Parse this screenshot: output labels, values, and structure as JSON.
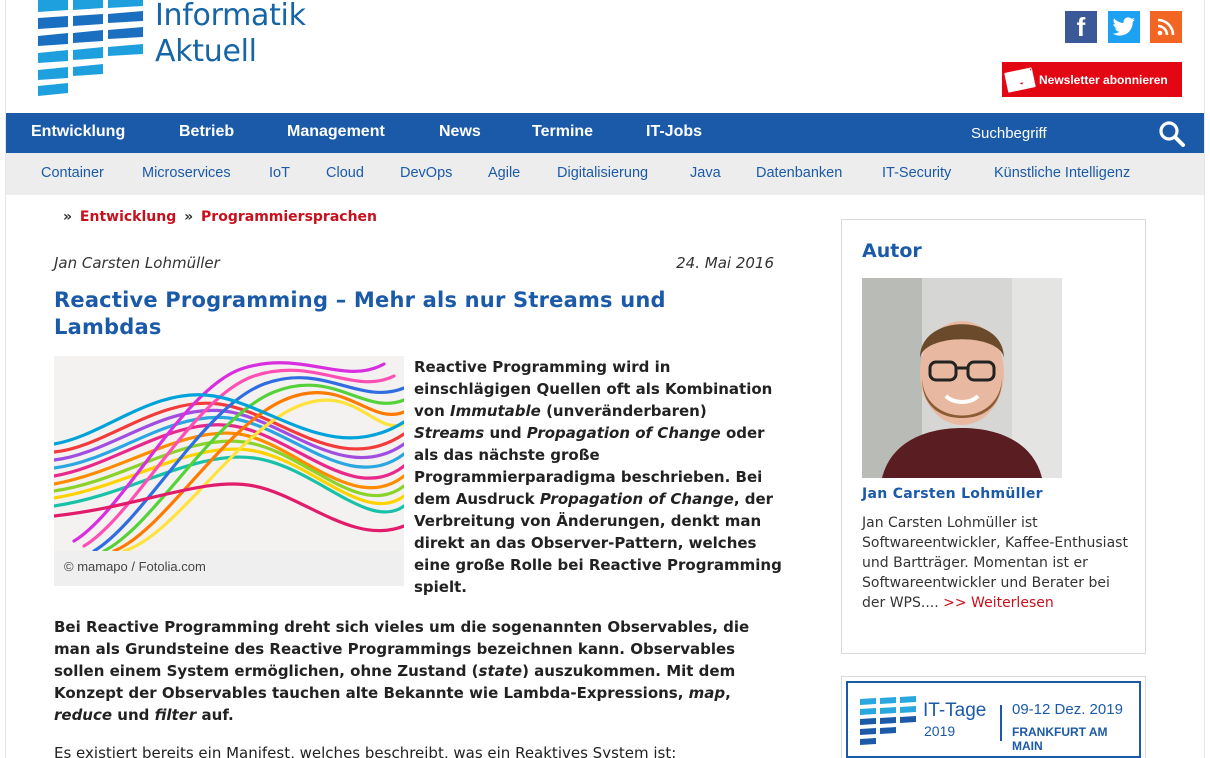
{
  "brand": {
    "name_line1": "Informatik",
    "name_line2": "Aktuell"
  },
  "social": [
    {
      "icon": "facebook-icon",
      "glyph": "f",
      "color": "#3b5998"
    },
    {
      "icon": "twitter-icon",
      "color": "#1da1f2"
    },
    {
      "icon": "rss-icon",
      "color": "#f26522"
    }
  ],
  "newsletter": {
    "label": "Newsletter abonnieren",
    "color": "#e30613"
  },
  "main_nav": {
    "items": [
      "Entwicklung",
      "Betrieb",
      "Management",
      "News",
      "Termine",
      "IT-Jobs"
    ],
    "search_label": "Suchbegriff",
    "color": "#1b5aa8"
  },
  "sub_nav": {
    "items": [
      "Container",
      "Microservices",
      "IoT",
      "Cloud",
      "DevOps",
      "Agile",
      "Digitalisierung",
      "Java",
      "Datenbanken",
      "IT-Security",
      "Künstliche Intelligenz"
    ]
  },
  "breadcrumb": {
    "sep": "»",
    "items": [
      "Entwicklung",
      "Programmiersprachen"
    ]
  },
  "article": {
    "author": "Jan Carsten Lohmüller",
    "date": "24. Mai 2016",
    "title": "Reactive Programming – Mehr als nur Streams und Lambdas",
    "image_credit": "© mamapo / Fotolia.com",
    "intro": {
      "t1": "Reactive Programming wird in einschlägigen Quellen oft als Kombination von ",
      "e1": "Immutable",
      "t2": " (unveränderbaren) ",
      "e2": "Streams",
      "t3": " und ",
      "e3": "Propagation of Change",
      "t4": " oder als das nächste große Programmierparadigma beschrieben. Bei dem Ausdruck ",
      "e4": "Propagation of Change",
      "t5": ", der Verbreitung von Änderungen, denkt man direkt an das Observer-Pattern, welches eine große Rolle bei Reactive Programming spielt."
    },
    "para2": {
      "t1": "Bei Reactive Programming dreht sich vieles um die sogenannten Observables, die man als Grundsteine des Reactive Programmings bezeichnen kann. Observables sollen einem System ermöglichen, ohne Zustand (",
      "e1": "state",
      "t2": ") auszukommen. Mit dem Konzept der Observables tauchen alte Bekannte wie Lambda-Expressions, ",
      "e2": "map",
      "t3": ", ",
      "e3": "reduce",
      "t4": " und ",
      "e4": "filter",
      "t5": " auf."
    },
    "para3": "Es existiert bereits ein Manifest, welches beschreibt, was ein Reaktives System ist:"
  },
  "sidebar": {
    "heading": "Autor",
    "author_name": "Jan Carsten Lohmüller",
    "bio": "Jan Carsten Lohmüller ist Softwareentwickler, Kaffee-Enthusiast und Bartträger. Momentan ist er Softwareentwickler und Berater bei der WPS.... ",
    "more": ">> Weiterlesen"
  },
  "banner": {
    "name": "IT-Tage",
    "year": "2019",
    "dates": "09-12 Dez. 2019",
    "city": "FRANKFURT AM MAIN"
  }
}
